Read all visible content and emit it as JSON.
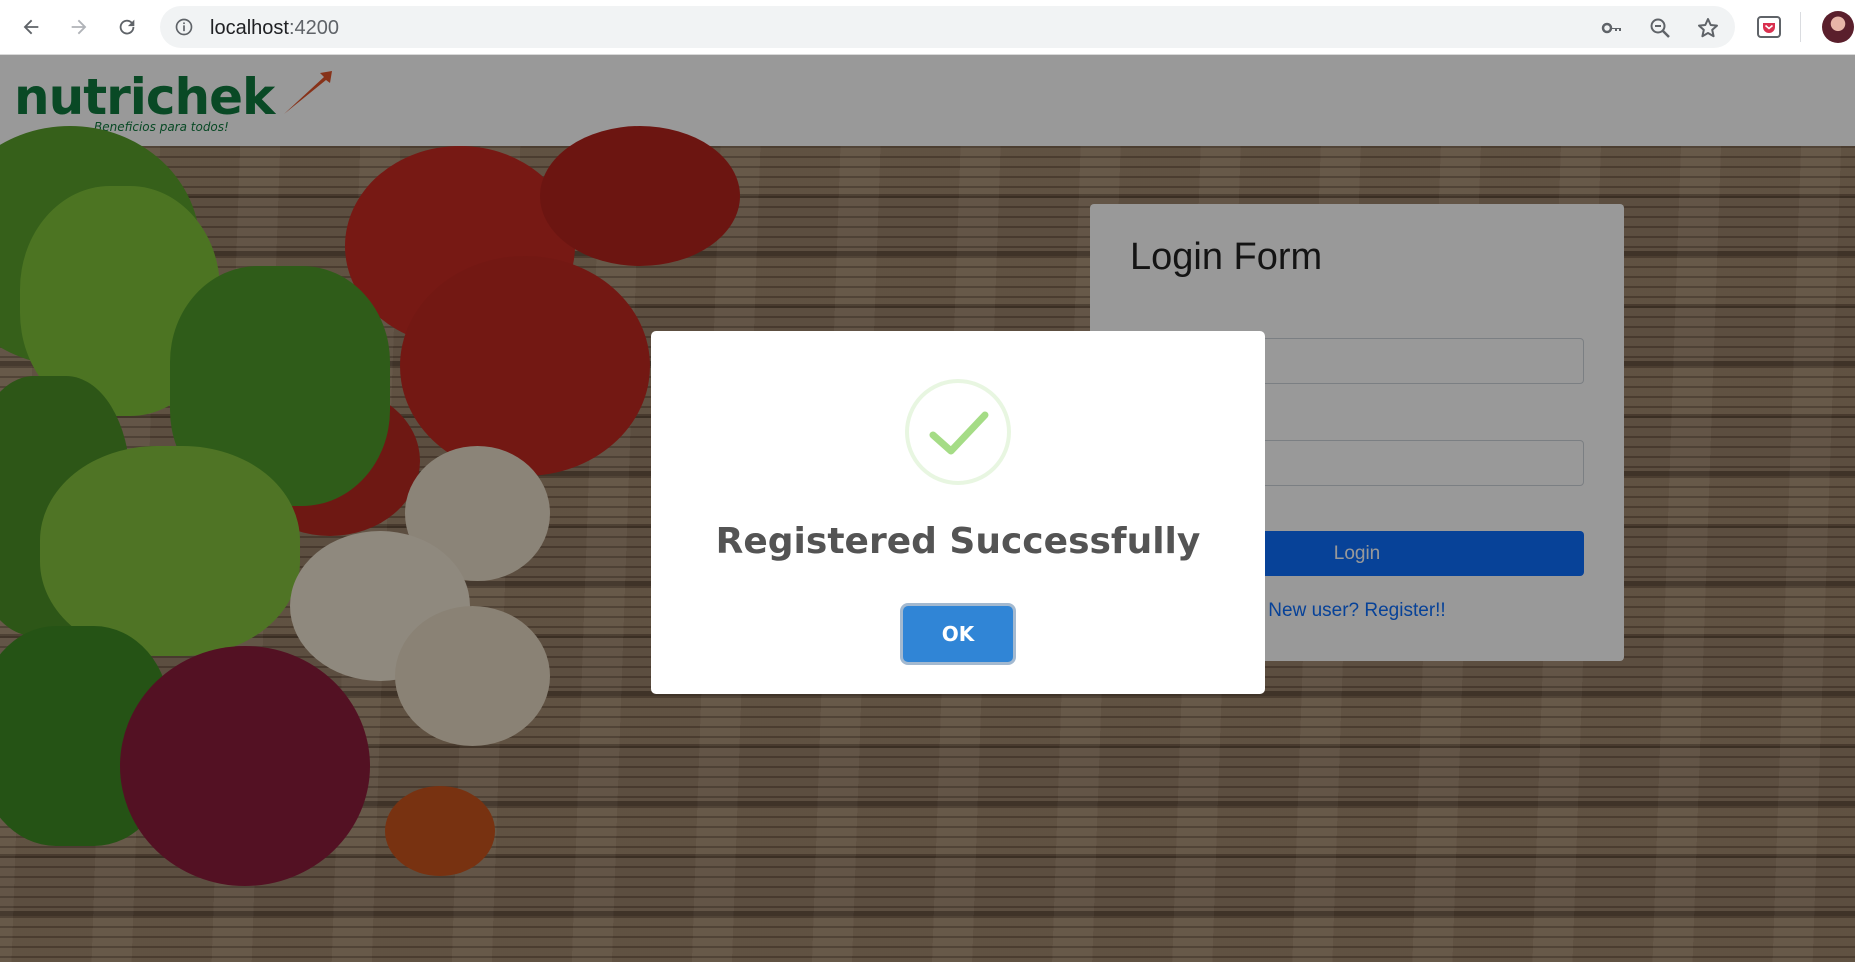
{
  "browser": {
    "url_host": "localhost",
    "url_port": ":4200",
    "icons": [
      "back-arrow-icon",
      "forward-arrow-icon",
      "reload-icon",
      "info-icon",
      "key-icon",
      "zoom-out-icon",
      "star-icon",
      "pocket-extension-icon",
      "profile-avatar"
    ]
  },
  "header": {
    "logo_text": "nutrichek",
    "logo_tagline": "Beneficios para todos!"
  },
  "login_form": {
    "title": "Login Form",
    "login_button": "Login",
    "register_link": "New user? Register!!"
  },
  "modal": {
    "title": "Registered Successfully",
    "ok_button": "OK",
    "icon": "success-check-icon"
  },
  "colors": {
    "brand_green": "#0f7a3e",
    "brand_orange": "#e2542a",
    "primary_blue": "#0d6efd",
    "ok_blue": "#3085d6",
    "success_green": "#a5dc86"
  }
}
